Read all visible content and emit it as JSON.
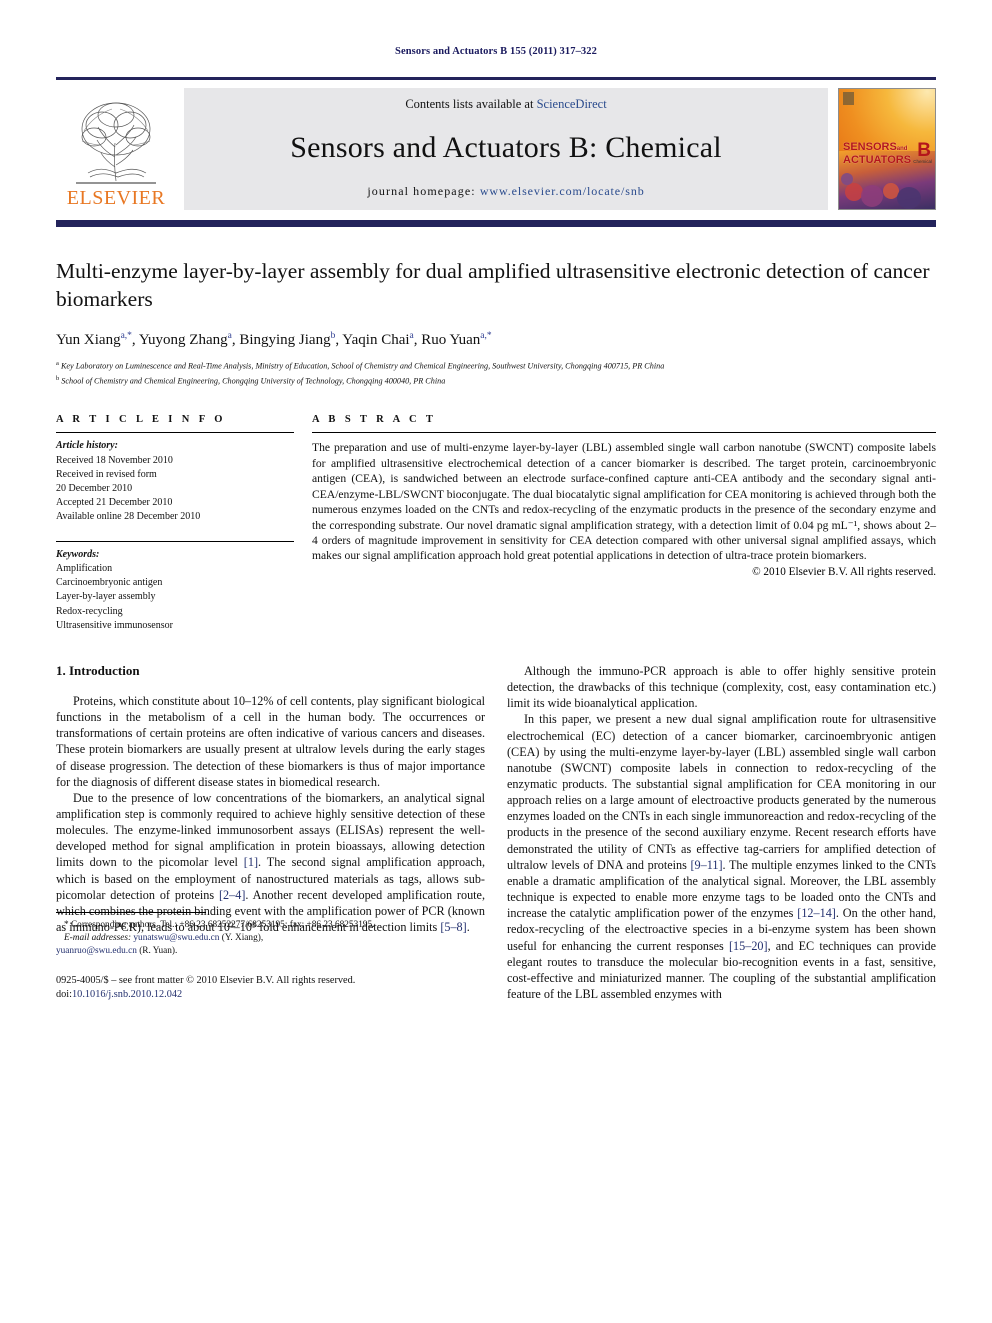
{
  "running_head": "Sensors and Actuators B 155 (2011) 317–322",
  "masthead": {
    "publisher_name": "ELSEVIER",
    "contents_prefix": "Contents lists available at ",
    "contents_link": "ScienceDirect",
    "journal_title": "Sensors and Actuators B: Chemical",
    "homepage_label": "journal homepage:",
    "homepage_url": "www.elsevier.com/locate/snb",
    "cover": {
      "line1": "SENSORS",
      "line1_small": "and",
      "line2": "ACTUATORS",
      "letter": "B",
      "sub": "Chemical"
    }
  },
  "article": {
    "title": "Multi-enzyme layer-by-layer assembly for dual amplified ultrasensitive electronic detection of cancer biomarkers",
    "authors_html": "Yun Xiang<sup>a,*</sup>, Yuyong Zhang<sup>a</sup>, Bingying Jiang<sup>b</sup>, Yaqin Chai<sup>a</sup>, Ruo Yuan<sup>a,*</sup>",
    "affiliation_a": "Key Laboratory on Luminescence and Real-Time Analysis, Ministry of Education, School of Chemistry and Chemical Engineering, Southwest University, Chongqing 400715, PR China",
    "affiliation_b": "School of Chemistry and Chemical Engineering, Chongqing University of Technology, Chongqing 400040, PR China"
  },
  "info": {
    "heading": "A R T I C L E  I N F O",
    "history_label": "Article history:",
    "history": [
      "Received 18 November 2010",
      "Received in revised form",
      "20 December 2010",
      "Accepted 21 December 2010",
      "Available online 28 December 2010"
    ],
    "keywords_label": "Keywords:",
    "keywords": [
      "Amplification",
      "Carcinoembryonic antigen",
      "Layer-by-layer assembly",
      "Redox-recycling",
      "Ultrasensitive immunosensor"
    ]
  },
  "abstract": {
    "heading": "A B S T R A C T",
    "text": "The preparation and use of multi-enzyme layer-by-layer (LBL) assembled single wall carbon nanotube (SWCNT) composite labels for amplified ultrasensitive electrochemical detection of a cancer biomarker is described. The target protein, carcinoembryonic antigen (CEA), is sandwiched between an electrode surface-confined capture anti-CEA antibody and the secondary signal anti-CEA/enzyme-LBL/SWCNT bioconjugate. The dual biocatalytic signal amplification for CEA monitoring is achieved through both the numerous enzymes loaded on the CNTs and redox-recycling of the enzymatic products in the presence of the secondary enzyme and the corresponding substrate. Our novel dramatic signal amplification strategy, with a detection limit of 0.04 pg mL⁻¹, shows about 2–4 orders of magnitude improvement in sensitivity for CEA detection compared with other universal signal amplified assays, which makes our signal amplification approach hold great potential applications in detection of ultra-trace protein biomarkers.",
    "copyright": "© 2010 Elsevier B.V. All rights reserved."
  },
  "body": {
    "section_number_title": "1.  Introduction",
    "left_paragraphs": [
      "Proteins, which constitute about 10–12% of cell contents, play significant biological functions in the metabolism of a cell in the human body. The occurrences or transformations of certain proteins are often indicative of various cancers and diseases. These protein biomarkers are usually present at ultralow levels during the early stages of disease progression. The detection of these biomarkers is thus of major importance for the diagnosis of different disease states in biomedical research.",
      "Due to the presence of low concentrations of the biomarkers, an analytical signal amplification step is commonly required to achieve highly sensitive detection of these molecules. The enzyme-linked immunosorbent assays (ELISAs) represent the well-developed method for signal amplification in protein bioassays, allowing detection limits down to the picomolar level [1]. The second signal amplification approach, which is based on the employment of nanostructured materials as tags, allows sub-picomolar detection of proteins [2–4]. Another recent developed amplification route, which combines the protein binding event with the amplification power of PCR (known as immuno-PCR), leads to about 10²–10⁵ fold enhancement in detection limits [5–8]."
    ],
    "right_paragraphs": [
      "Although the immuno-PCR approach is able to offer highly sensitive protein detection, the drawbacks of this technique (complexity, cost, easy contamination etc.) limit its wide bioanalytical application.",
      "In this paper, we present a new dual signal amplification route for ultrasensitive electrochemical (EC) detection of a cancer biomarker, carcinoembryonic antigen (CEA) by using the multi-enzyme layer-by-layer (LBL) assembled single wall carbon nanotube (SWCNT) composite labels in connection to redox-recycling of the enzymatic products. The substantial signal amplification for CEA monitoring in our approach relies on a large amount of electroactive products generated by the numerous enzymes loaded on the CNTs in each single immunoreaction and redox-recycling of the products in the presence of the second auxiliary enzyme. Recent research efforts have demonstrated the utility of CNTs as effective tag-carriers for amplified detection of ultralow levels of DNA and proteins [9–11]. The multiple enzymes linked to the CNTs enable a dramatic amplification of the analytical signal. Moreover, the LBL assembly technique is expected to enable more enzyme tags to be loaded onto the CNTs and increase the catalytic amplification power of the enzymes [12–14]. On the other hand, redox-recycling of the electroactive species in a bi-enzyme system has been shown useful for enhancing the current responses [15–20], and EC techniques can provide elegant routes to transduce the molecular bio-recognition events in a fast, sensitive, cost-effective and miniaturized manner. The coupling of the substantial amplification feature of the LBL assembled enzymes with"
    ]
  },
  "footnotes": {
    "line1": "* Corresponding authors. Tel.: +86 23 68252277/68253195; fax: +86 23 68253195.",
    "email_label": "E-mail addresses:",
    "email1": "yunatswu@swu.edu.cn",
    "email1_owner": "(Y. Xiang),",
    "email2": "yuanruo@swu.edu.cn",
    "email2_owner": "(R. Yuan).",
    "imprint": "0925-4005/$ – see front matter © 2010 Elsevier B.V. All rights reserved.",
    "doi_label": "doi:",
    "doi_value": "10.1016/j.snb.2010.12.042"
  }
}
